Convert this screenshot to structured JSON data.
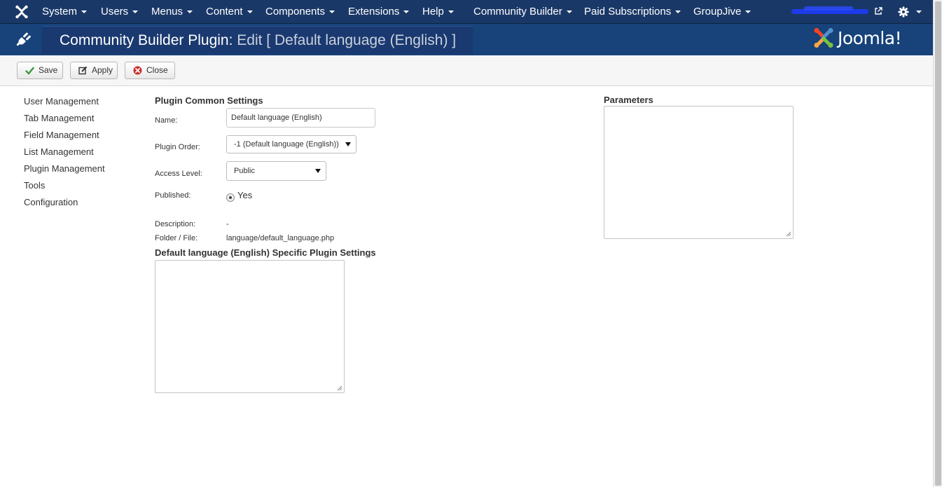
{
  "navbar": {
    "menus": [
      {
        "label": "System"
      },
      {
        "label": "Users"
      },
      {
        "label": "Menus"
      },
      {
        "label": "Content"
      },
      {
        "label": "Components"
      },
      {
        "label": "Extensions"
      },
      {
        "label": "Help"
      },
      {
        "label": "Community Builder"
      },
      {
        "label": "Paid Subscriptions"
      },
      {
        "label": "GroupJive"
      }
    ],
    "icons": {
      "logo": "joomla-logo-icon",
      "external": "external-link-icon",
      "settings": "gear-icon"
    }
  },
  "header": {
    "title": "Community Builder Plugin:",
    "subtitle": "Edit [ Default language (English) ]",
    "brand": "Joomla!",
    "icon": "plug-icon"
  },
  "toolbar": {
    "save_label": "Save",
    "apply_label": "Apply",
    "close_label": "Close"
  },
  "sidebar": {
    "items": [
      {
        "label": "User Management"
      },
      {
        "label": "Tab Management"
      },
      {
        "label": "Field Management"
      },
      {
        "label": "List Management"
      },
      {
        "label": "Plugin Management"
      },
      {
        "label": "Tools"
      },
      {
        "label": "Configuration"
      }
    ]
  },
  "form": {
    "common_title": "Plugin Common Settings",
    "name_label": "Name:",
    "name_value": "Default language (English)",
    "order_label": "Plugin Order:",
    "order_value": "-1 (Default language (English))",
    "access_label": "Access Level:",
    "access_value": "Public",
    "published_label": "Published:",
    "published_value": "Yes",
    "description_label": "Description:",
    "description_value": "-",
    "folder_label": "Folder / File:",
    "folder_value": "language/default_language.php",
    "specific_title": "Default language (English) Specific Plugin Settings",
    "parameters_title": "Parameters"
  },
  "colors": {
    "navbar": "#1a3867",
    "header": "#17427a",
    "save_icon": "#3a9a3a",
    "close_icon": "#c9302c"
  }
}
